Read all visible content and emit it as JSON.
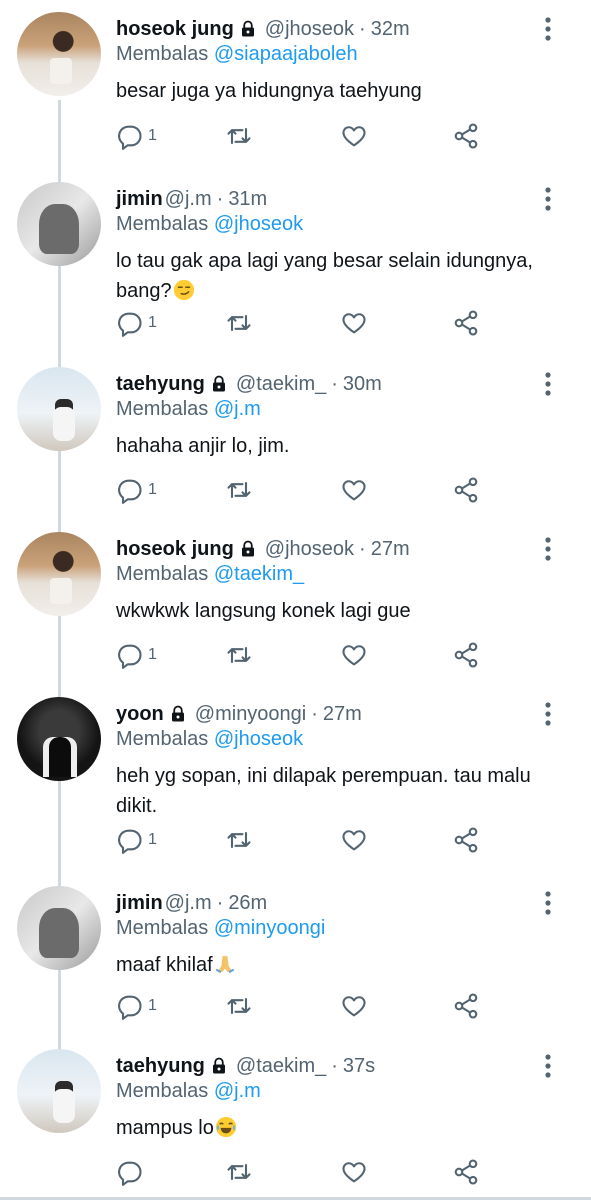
{
  "tweets": [
    {
      "name": "hoseok jung",
      "locked": true,
      "handle": "@jhoseok",
      "dot": "·",
      "time": "32m",
      "reply_prefix": "Membalas",
      "reply_to": "@siapaajaboleh",
      "text": "besar juga ya hidungnya taehyung",
      "emoji": "",
      "reply_count": "1",
      "avatar": "hoseok"
    },
    {
      "name": "jimin",
      "locked": false,
      "handle": "@j.m",
      "dot": "·",
      "time": "31m",
      "reply_prefix": "Membalas",
      "reply_to": "@jhoseok",
      "text": "lo tau gak apa lagi yang besar selain idungnya, bang?",
      "emoji": "smirk",
      "reply_count": "1",
      "avatar": "jimin"
    },
    {
      "name": "taehyung",
      "locked": true,
      "handle": "@taekim_",
      "dot": "·",
      "time": "30m",
      "reply_prefix": "Membalas",
      "reply_to": "@j.m",
      "text": "hahaha anjir lo, jim.",
      "emoji": "",
      "reply_count": "1",
      "avatar": "tae"
    },
    {
      "name": "hoseok jung",
      "locked": true,
      "handle": "@jhoseok",
      "dot": "·",
      "time": "27m",
      "reply_prefix": "Membalas",
      "reply_to": "@taekim_",
      "text": "wkwkwk langsung konek lagi gue",
      "emoji": "",
      "reply_count": "1",
      "avatar": "hoseok"
    },
    {
      "name": "yoon",
      "locked": true,
      "handle": "@minyoongi",
      "dot": "·",
      "time": "27m",
      "reply_prefix": "Membalas",
      "reply_to": "@jhoseok",
      "text": "heh yg sopan, ini dilapak perempuan. tau malu dikit.",
      "emoji": "",
      "reply_count": "1",
      "avatar": "yoon"
    },
    {
      "name": "jimin",
      "locked": false,
      "handle": "@j.m",
      "dot": "·",
      "time": "26m",
      "reply_prefix": "Membalas",
      "reply_to": "@minyoongi",
      "text": "maaf khilaf",
      "emoji": "pray",
      "reply_count": "1",
      "avatar": "jimin"
    },
    {
      "name": "taehyung",
      "locked": true,
      "handle": "@taekim_",
      "dot": "·",
      "time": "37s",
      "reply_prefix": "Membalas",
      "reply_to": "@j.m",
      "text": "mampus lo",
      "emoji": "joy",
      "reply_count": "",
      "avatar": "tae"
    }
  ],
  "icons": {
    "reply": "reply-icon",
    "retweet": "retweet-icon",
    "like": "heart-icon",
    "share": "share-icon",
    "more": "more-vertical-icon",
    "lock": "lock-icon"
  },
  "colors": {
    "text": "#0f1419",
    "secondary": "#536471",
    "link": "#1d9bf0",
    "thread_line": "#cfd9de"
  }
}
